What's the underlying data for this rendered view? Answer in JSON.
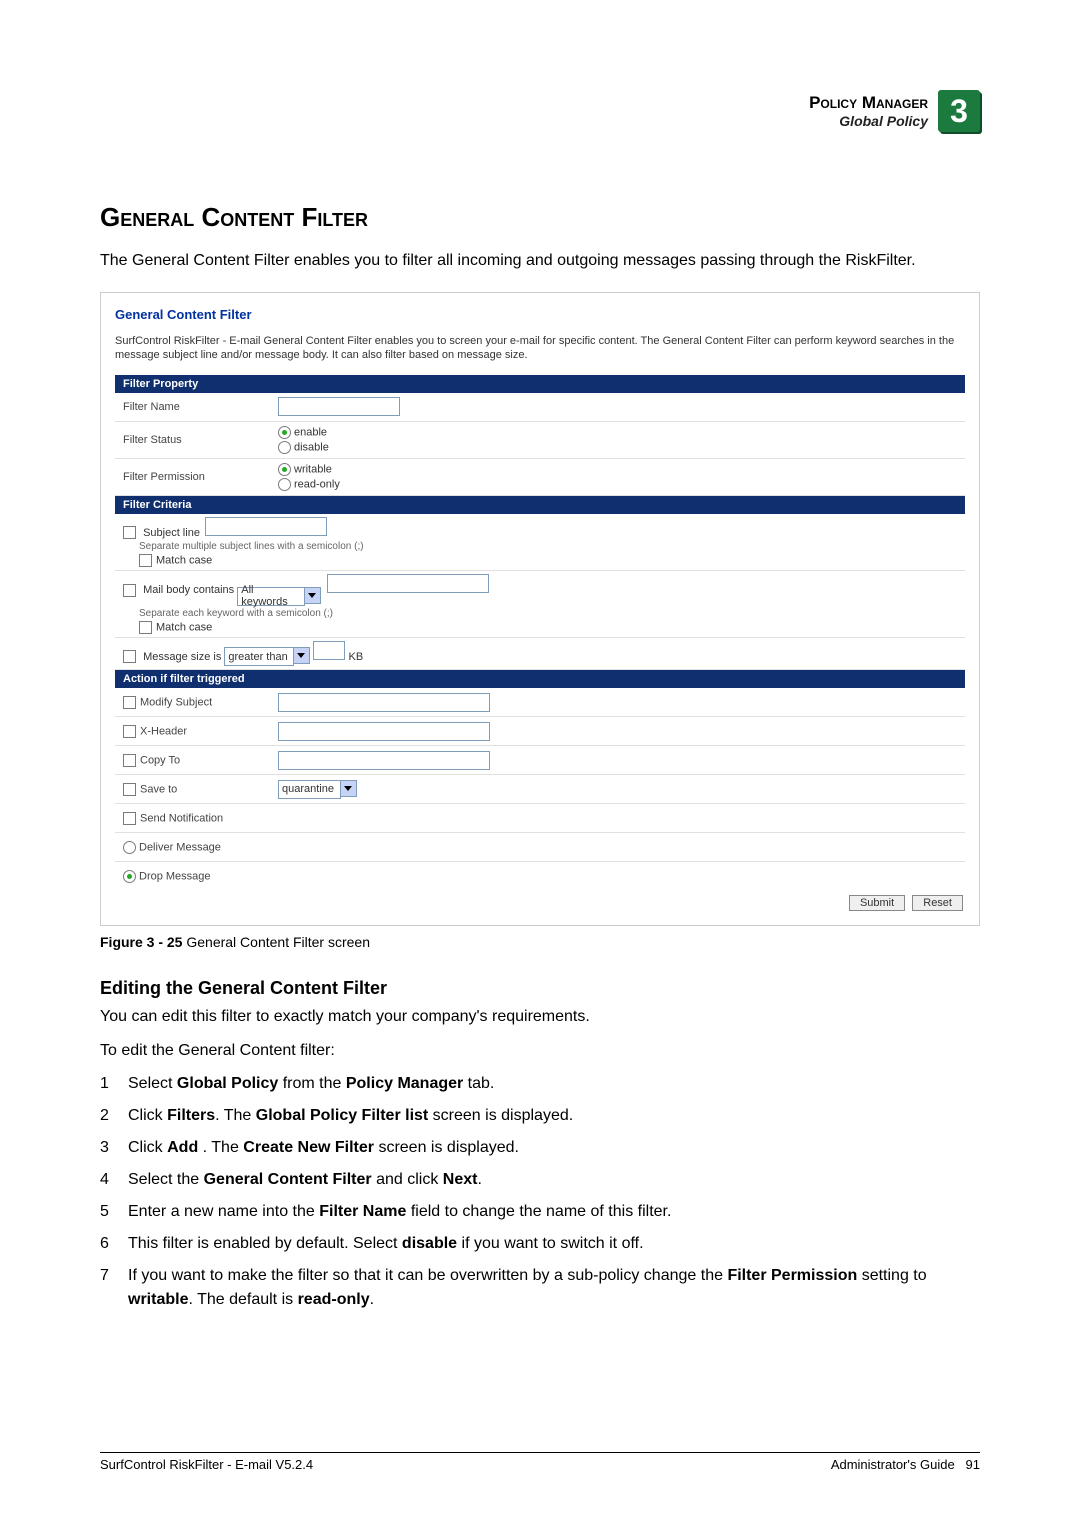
{
  "header": {
    "title": "Policy Manager",
    "subtitle": "Global Policy",
    "chapter": "3"
  },
  "section": {
    "title": "General Content Filter",
    "intro": "The General Content Filter enables you to filter all incoming and outgoing messages passing through the RiskFilter."
  },
  "screenshot": {
    "title": "General Content Filter",
    "desc": "SurfControl RiskFilter - E-mail General Content Filter enables you to screen your e-mail for specific content. The General Content Filter can perform keyword searches in the message subject line and/or message body. It can also filter based on message size.",
    "bands": {
      "filter_property": "Filter Property",
      "filter_criteria": "Filter Criteria",
      "action": "Action if filter triggered"
    },
    "rows": {
      "filter_name": "Filter Name",
      "filter_status": "Filter Status",
      "enable": "enable",
      "disable": "disable",
      "filter_permission": "Filter Permission",
      "writable": "writable",
      "readonly": "read-only",
      "subject_line": "Subject line",
      "sep_subject": "Separate multiple subject lines with a semicolon (;)",
      "match_case": "Match case",
      "mail_body": "Mail body contains",
      "all_keywords": "All keywords",
      "sep_keyword": "Separate each keyword with a semicolon (;)",
      "msg_size": "Message size is",
      "greater_than": "greater than",
      "kb": "KB",
      "modify_subject": "Modify Subject",
      "xheader": "X-Header",
      "copy_to": "Copy To",
      "save_to": "Save to",
      "quarantine": "quarantine",
      "send_notif": "Send Notification",
      "deliver": "Deliver Message",
      "drop": "Drop Message"
    },
    "buttons": {
      "submit": "Submit",
      "reset": "Reset"
    }
  },
  "figure": {
    "label": "Figure 3 - 25",
    "caption": " General Content Filter screen"
  },
  "subsection": {
    "title": "Editing the General Content Filter",
    "p1": "You can edit this filter to exactly match your company's requirements.",
    "p2": "To edit the General Content filter:"
  },
  "steps": [
    {
      "n": "1",
      "pre": "Select ",
      "b1": "Global Policy",
      "mid": " from the ",
      "b2": "Policy Manager",
      "post": " tab."
    },
    {
      "n": "2",
      "pre": "Click ",
      "b1": "Filters",
      "mid": ". The ",
      "b2": "Global Policy Filter list",
      "post": " screen is displayed."
    },
    {
      "n": "3",
      "pre": "Click ",
      "b1": "Add",
      "mid": " . The ",
      "b2": "Create New Filter",
      "post": " screen is displayed."
    },
    {
      "n": "4",
      "pre": "Select the ",
      "b1": "General Content Filter",
      "mid": " and click ",
      "b2": "Next",
      "post": "."
    },
    {
      "n": "5",
      "pre": "Enter a new name into the ",
      "b1": "Filter Name",
      "mid": " field to change the name of this filter.",
      "b2": "",
      "post": ""
    },
    {
      "n": "6",
      "pre": "This filter is enabled by default. Select ",
      "b1": "disable",
      "mid": " if you want to switch it off.",
      "b2": "",
      "post": ""
    },
    {
      "n": "7",
      "pre": "If you want to make the filter so that it can be overwritten by a sub-policy change the ",
      "b1": "Filter Permission",
      "mid": " setting to ",
      "b2": "writable",
      "post": ". The default is ",
      "b3": "read-only",
      "post2": "."
    }
  ],
  "footer": {
    "left": "SurfControl RiskFilter - E-mail V5.2.4",
    "right_label": "Administrator's Guide",
    "page": "91"
  }
}
